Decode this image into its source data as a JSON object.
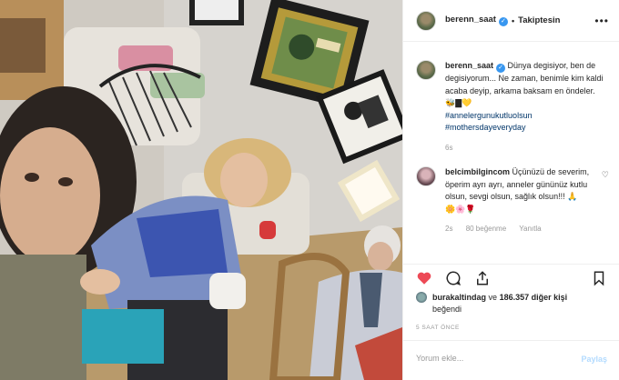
{
  "post_header": {
    "username": "berenn_saat",
    "follow_status": "Takiptesin"
  },
  "caption": {
    "username": "berenn_saat",
    "text": "Dünya degisiyor, ben de degisiyorum... Ne zaman, benimle kim kaldi acaba deyip, arkama baksam en öndeler. 🐝▇💛",
    "hashtags": [
      "#annelergunukutluolsun",
      "#mothersdayeveryday"
    ],
    "age": "6s"
  },
  "comment": {
    "username": "belcimbilgincom",
    "text": "Üçünüzü de severim, öperim ayrı ayrı, anneler gününüz kutlu olsun, sevgi olsun, sağlık olsun!!! 🙏",
    "emojis": "🌼🌸🌹",
    "age": "2s",
    "likes": "80 beğenme",
    "reply_label": "Yanıtla"
  },
  "likes": {
    "first_user": "burakaltindag",
    "connector": "ve",
    "count_text": "186.357 diğer kişi",
    "suffix": "beğendi"
  },
  "timestamp": "5 SAAT ÖNCE",
  "add_comment": {
    "placeholder": "Yorum ekle...",
    "share_label": "Paylaş"
  },
  "icons": {
    "like": "heart-icon",
    "comment": "comment-icon",
    "share": "share-icon",
    "save": "bookmark-icon",
    "more": "more-icon"
  },
  "colors": {
    "like_red": "#ed4956",
    "verified_blue": "#3897f0",
    "hashtag_blue": "#003569"
  }
}
